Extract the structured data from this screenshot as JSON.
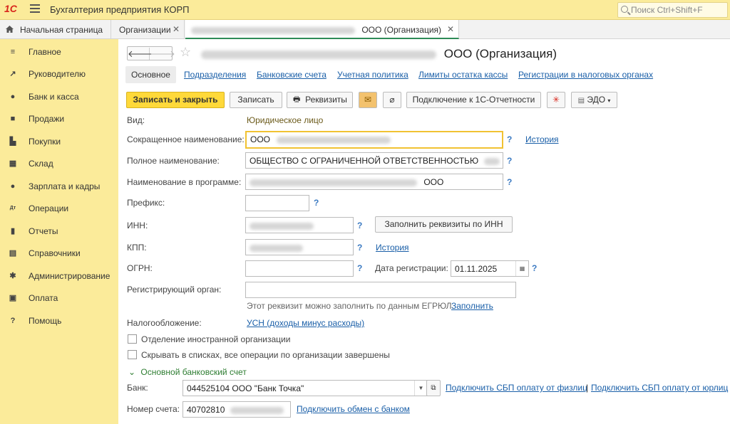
{
  "app": {
    "logo_text": "1С",
    "title": "Бухгалтерия предприятия КОРП",
    "search_placeholder": "Поиск Ctrl+Shift+F"
  },
  "tabs": [
    {
      "label": "Начальная страница",
      "icon": "home-icon"
    },
    {
      "label": "Организации"
    },
    {
      "label": "ООО (Организация)",
      "active": true
    }
  ],
  "sidebar": {
    "items": [
      {
        "label": "Главное",
        "icon": "menu-icon",
        "glyph": "≡"
      },
      {
        "label": "Руководителю",
        "icon": "trend-icon",
        "glyph": "↗"
      },
      {
        "label": "Банк и касса",
        "icon": "coin-icon",
        "glyph": "●"
      },
      {
        "label": "Продажи",
        "icon": "bag-icon",
        "glyph": "■"
      },
      {
        "label": "Покупки",
        "icon": "cart-icon",
        "glyph": "▙"
      },
      {
        "label": "Склад",
        "icon": "warehouse-icon",
        "glyph": "▦"
      },
      {
        "label": "Зарплата и кадры",
        "icon": "person-icon",
        "glyph": "●"
      },
      {
        "label": "Операции",
        "icon": "dtkt-icon",
        "glyph": "Дт"
      },
      {
        "label": "Отчеты",
        "icon": "barchart-icon",
        "glyph": "▮"
      },
      {
        "label": "Справочники",
        "icon": "books-icon",
        "glyph": "▤"
      },
      {
        "label": "Администрирование",
        "icon": "gear-icon",
        "glyph": "✱"
      },
      {
        "label": "Оплата",
        "icon": "payment-icon",
        "glyph": "▣"
      },
      {
        "label": "Помощь",
        "icon": "help-icon",
        "glyph": "?"
      }
    ]
  },
  "form": {
    "title": "ООО (Организация)",
    "subtabs": [
      "Основное",
      "Подразделения",
      "Банковские счета",
      "Учетная политика",
      "Лимиты остатка кассы",
      "Регистрации в налоговых органах"
    ],
    "toolbar": {
      "save_close": "Записать и закрыть",
      "save": "Записать",
      "requisites": "Реквизиты",
      "connect_reporting": "Подключение к 1С-Отчетности",
      "edo": "ЭДО"
    },
    "vid_label": "Вид:",
    "vid_value": "Юридическое лицо",
    "short_name_label": "Сокращенное наименование:",
    "short_name_value": "ООО",
    "history_link": "История",
    "full_name_label": "Полное наименование:",
    "full_name_value": "ОБЩЕСТВО С ОГРАНИЧЕННОЙ ОТВЕТСТВЕННОСТЬЮ",
    "program_name_label": "Наименование в программе:",
    "program_name_value": "ООО",
    "prefix_label": "Префикс:",
    "inn_label": "ИНН:",
    "fill_by_inn": "Заполнить реквизиты по ИНН",
    "kpp_label": "КПП:",
    "kpp_history": "История",
    "ogrn_label": "ОГРН:",
    "reg_date_label": "Дата регистрации:",
    "reg_date_value": "01.11.2025",
    "reg_organ_label": "Регистрирующий орган:",
    "egrul_hint": "Этот реквизит можно заполнить по данным ЕГРЮЛ.",
    "egrul_fill": "Заполнить",
    "tax_label": "Налогообложение:",
    "tax_value": "УСН (доходы минус расходы)",
    "foreign_branch": "Отделение иностранной организации",
    "hide_in_lists": "Скрывать в списках, все операции по организации завершены",
    "bank_section": "Основной банковский счет",
    "bank_label": "Банк:",
    "bank_value": "044525104 ООО \"Банк Точка\"",
    "sbp_phys": "Подключить СБП оплату от физлиц",
    "separator": "|",
    "sbp_jur": "Подключить СБП оплату от юрлиц",
    "account_label": "Номер счета:",
    "account_value": "40702810",
    "bank_exchange": "Подключить обмен с банком",
    "help_mark": "?"
  },
  "colors": {
    "sidebar_bg": "#fbeb9a",
    "primary_button": "#ffd93a",
    "link": "#1a5fa8",
    "active_tab_underline": "#2e8b57"
  }
}
